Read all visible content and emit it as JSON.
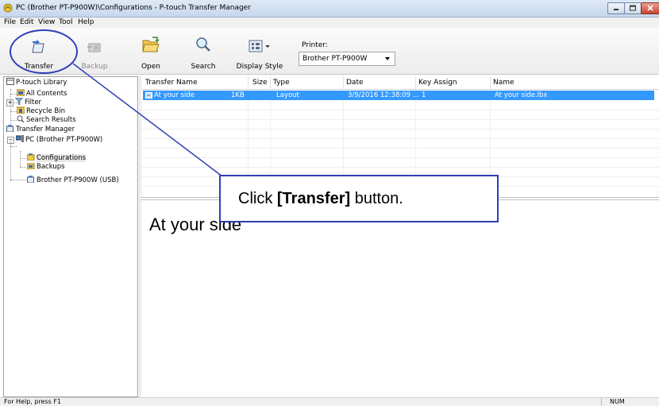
{
  "window": {
    "title": "PC (Brother PT-P900W)\\Configurations - P-touch Transfer Manager"
  },
  "menu": [
    "File",
    "Edit",
    "View",
    "Tool",
    "Help"
  ],
  "toolbar": {
    "transfer": "Transfer",
    "backup": "Backup",
    "open": "Open",
    "search": "Search",
    "display_style": "Display Style",
    "printer_label": "Printer:",
    "printer_value": "Brother PT-P900W"
  },
  "tree": {
    "library": "P-touch Library",
    "all_contents": "All Contents",
    "filter": "Filter",
    "recycle_bin": "Recycle Bin",
    "search_results": "Search Results",
    "transfer_manager": "Transfer Manager",
    "pc": "PC (Brother PT-P900W)",
    "configurations": "Configurations",
    "backups": "Backups",
    "usb_printer": "Brother PT-P900W (USB)"
  },
  "table": {
    "columns": [
      "Transfer Name",
      "Size",
      "Type",
      "Date",
      "Key Assign",
      "Name"
    ],
    "rows": [
      {
        "transfer_name": "At your side",
        "size": "1KB",
        "type": "Layout",
        "date": "3/9/2016 12:38:09 ...",
        "key_assign": "1",
        "name": "At your side.lbx"
      }
    ]
  },
  "preview": {
    "text": "At your side"
  },
  "status": {
    "help": "For Help, press F1",
    "num": "NUM"
  },
  "callout": {
    "prefix": "Click ",
    "bold": "[Transfer]",
    "suffix": " button."
  },
  "colors": {
    "selection": "#3399ff",
    "annotation": "#2f3fb5"
  }
}
